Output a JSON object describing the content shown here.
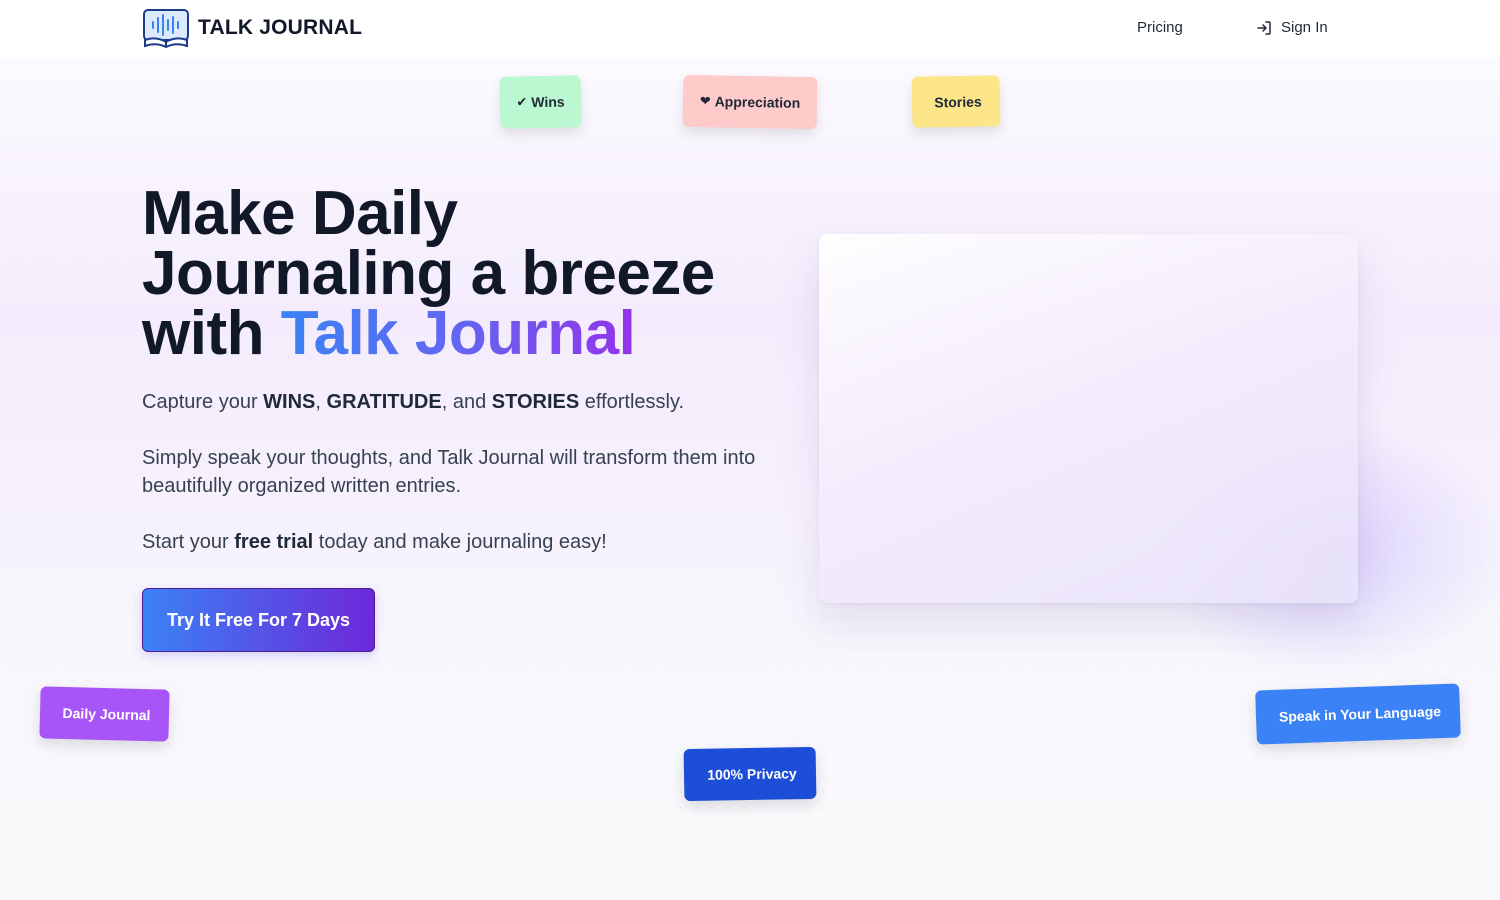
{
  "brand": {
    "name": "TALK JOURNAL",
    "logo_icon": "microphone-book-icon"
  },
  "nav": {
    "pricing": "Pricing",
    "sign_in": "Sign In",
    "sign_in_icon": "sign-in-arrow-icon"
  },
  "tags": {
    "wins": {
      "glyph": "✔",
      "label": "Wins",
      "color": "#bbf7d0"
    },
    "appreciation": {
      "glyph": "❤",
      "label": "Appreciation",
      "color": "#fecaca"
    },
    "stories": {
      "glyph": "",
      "label": "Stories",
      "color": "#fde68a"
    }
  },
  "hero": {
    "title_line1": "Make Daily",
    "title_line2": "Journaling a breeze",
    "title_line3_prefix": "with ",
    "title_accent": "Talk Journal",
    "p1_pre": "Capture your ",
    "p1_wins": "WINS",
    "p1_sep1": ", ",
    "p1_gratitude": "GRATITUDE",
    "p1_sep2": ", and ",
    "p1_stories": "STORIES",
    "p1_post": " effortlessly.",
    "p2": "Simply speak your thoughts, and Talk Journal will transform them into beautifully organized written entries.",
    "p3_pre": "Start your ",
    "p3_bold": "free trial",
    "p3_post": " today and make journaling easy!",
    "cta": "Try It Free For 7 Days"
  },
  "pills": {
    "daily": {
      "glyph": "",
      "label": "Daily Journal",
      "color": "#a855f7"
    },
    "privacy": {
      "glyph": "",
      "label": "100% Privacy",
      "color": "#1d4ed8"
    },
    "language": {
      "glyph": "",
      "label": "Speak in Your Language",
      "color": "#3b82f6"
    }
  },
  "colors": {
    "accent_start": "#3b82f6",
    "accent_end": "#9333ea",
    "text": "#111827"
  }
}
